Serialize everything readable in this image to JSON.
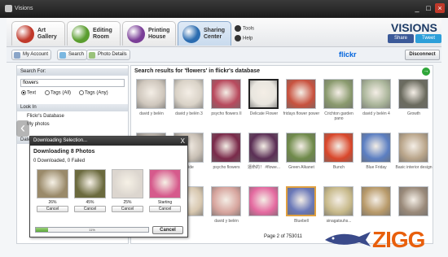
{
  "window": {
    "title": "Visions"
  },
  "ribbon": {
    "tabs": [
      {
        "line1": "Art",
        "line2": "Gallery",
        "color": "#c0392b",
        "active": false
      },
      {
        "line1": "Editing",
        "line2": "Room",
        "color": "#5a9d2f",
        "active": false
      },
      {
        "line1": "Printing",
        "line2": "House",
        "color": "#7a3e97",
        "active": false
      },
      {
        "line1": "Sharing",
        "line2": "Center",
        "color": "#2b6cb0",
        "active": true
      }
    ],
    "tools_label": "Tools",
    "help_label": "Help",
    "logo": "VISIONS",
    "share_label": "Share",
    "tweet_label": "Tweet"
  },
  "subtoolbar": {
    "my_account": "My Account",
    "search": "Search",
    "photo_details": "Photo Details",
    "service": "flickr",
    "disconnect": "Disconnect"
  },
  "leftpanel": {
    "search_for_title": "Search For:",
    "search_value": "flowers",
    "radio_text": "Text",
    "radio_tags_all": "Tags (All)",
    "radio_tags_any": "Tags (Any)",
    "look_in_title": "Look In",
    "look_items": [
      "Flickr's Database",
      "My photos"
    ],
    "date_title": "Date"
  },
  "results": {
    "title": "Search results for 'flowers' in flickr's database",
    "page_info": "Page 2 of 753011",
    "thumbnails": [
      {
        "caption": "david y belén",
        "color": "#cfc7bd"
      },
      {
        "caption": "david y belén 3",
        "color": "#d9d2c7"
      },
      {
        "caption": "psycho flowers II",
        "color": "#b84a5e"
      },
      {
        "caption": "Delicate Flower",
        "color": "#e9e6df"
      },
      {
        "caption": "fridays flower power",
        "color": "#c8523f"
      },
      {
        "caption": "Crichton garden pano",
        "color": "#8a9a6e"
      },
      {
        "caption": "david y belén 4",
        "color": "#aab59a"
      },
      {
        "caption": "Growth",
        "color": "#6b6b5f"
      },
      {
        "caption": "",
        "color": "#b7b0a8"
      },
      {
        "caption": "Bride",
        "color": "#c9c0b5"
      },
      {
        "caption": "psycho flowers",
        "color": "#7a2a4a"
      },
      {
        "caption": "運命的！ #flowe...",
        "color": "#5b2f55"
      },
      {
        "caption": "Green Alkanet",
        "color": "#6f8a4a"
      },
      {
        "caption": "Bunch",
        "color": "#d9472b"
      },
      {
        "caption": "Blue Friday",
        "color": "#5c7fc2"
      },
      {
        "caption": "Basic interior design",
        "color": "#b9a58a"
      },
      {
        "caption": "",
        "color": "#caa27a"
      },
      {
        "caption": "",
        "color": "#d8c8b0"
      },
      {
        "caption": "david y belén",
        "color": "#d7a59e"
      },
      {
        "caption": "",
        "color": "#e46aa0"
      },
      {
        "caption": "Bluebell",
        "color": "#6a78b8"
      },
      {
        "caption": "sinagatsuhs...",
        "color": "#c7b98a"
      },
      {
        "caption": "",
        "color": "#b89a6a"
      },
      {
        "caption": "",
        "color": "#9a8a7a"
      }
    ]
  },
  "dialog": {
    "title": "Downloading Selection...",
    "close": "X",
    "heading": "Downloading 8 Photos",
    "status": "0 Downloaded, 0 Failed",
    "items": [
      {
        "percent": "26%",
        "cancel": "Cancel",
        "color": "#9a8a6a"
      },
      {
        "percent": "45%",
        "cancel": "Cancel",
        "color": "#6b6a3e"
      },
      {
        "percent": "25%",
        "cancel": "Cancel",
        "color": "#dcd6cf"
      },
      {
        "percent": "Starting",
        "cancel": "Cancel",
        "color": "#d65a8c"
      }
    ],
    "overall_percent_label": "11%",
    "overall_progress": 0.11,
    "cancel": "Cancel"
  },
  "watermark": {
    "text": "ZIGG"
  }
}
